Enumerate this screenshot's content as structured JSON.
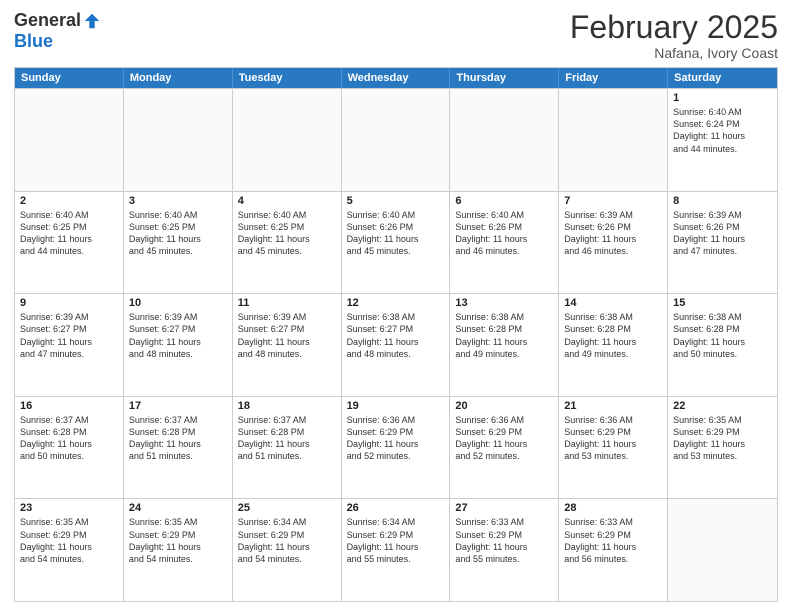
{
  "header": {
    "logo_general": "General",
    "logo_blue": "Blue",
    "month_title": "February 2025",
    "location": "Nafana, Ivory Coast"
  },
  "weekdays": [
    "Sunday",
    "Monday",
    "Tuesday",
    "Wednesday",
    "Thursday",
    "Friday",
    "Saturday"
  ],
  "weeks": [
    [
      {
        "day": "",
        "info": ""
      },
      {
        "day": "",
        "info": ""
      },
      {
        "day": "",
        "info": ""
      },
      {
        "day": "",
        "info": ""
      },
      {
        "day": "",
        "info": ""
      },
      {
        "day": "",
        "info": ""
      },
      {
        "day": "1",
        "info": "Sunrise: 6:40 AM\nSunset: 6:24 PM\nDaylight: 11 hours\nand 44 minutes."
      }
    ],
    [
      {
        "day": "2",
        "info": "Sunrise: 6:40 AM\nSunset: 6:25 PM\nDaylight: 11 hours\nand 44 minutes."
      },
      {
        "day": "3",
        "info": "Sunrise: 6:40 AM\nSunset: 6:25 PM\nDaylight: 11 hours\nand 45 minutes."
      },
      {
        "day": "4",
        "info": "Sunrise: 6:40 AM\nSunset: 6:25 PM\nDaylight: 11 hours\nand 45 minutes."
      },
      {
        "day": "5",
        "info": "Sunrise: 6:40 AM\nSunset: 6:26 PM\nDaylight: 11 hours\nand 45 minutes."
      },
      {
        "day": "6",
        "info": "Sunrise: 6:40 AM\nSunset: 6:26 PM\nDaylight: 11 hours\nand 46 minutes."
      },
      {
        "day": "7",
        "info": "Sunrise: 6:39 AM\nSunset: 6:26 PM\nDaylight: 11 hours\nand 46 minutes."
      },
      {
        "day": "8",
        "info": "Sunrise: 6:39 AM\nSunset: 6:26 PM\nDaylight: 11 hours\nand 47 minutes."
      }
    ],
    [
      {
        "day": "9",
        "info": "Sunrise: 6:39 AM\nSunset: 6:27 PM\nDaylight: 11 hours\nand 47 minutes."
      },
      {
        "day": "10",
        "info": "Sunrise: 6:39 AM\nSunset: 6:27 PM\nDaylight: 11 hours\nand 48 minutes."
      },
      {
        "day": "11",
        "info": "Sunrise: 6:39 AM\nSunset: 6:27 PM\nDaylight: 11 hours\nand 48 minutes."
      },
      {
        "day": "12",
        "info": "Sunrise: 6:38 AM\nSunset: 6:27 PM\nDaylight: 11 hours\nand 48 minutes."
      },
      {
        "day": "13",
        "info": "Sunrise: 6:38 AM\nSunset: 6:28 PM\nDaylight: 11 hours\nand 49 minutes."
      },
      {
        "day": "14",
        "info": "Sunrise: 6:38 AM\nSunset: 6:28 PM\nDaylight: 11 hours\nand 49 minutes."
      },
      {
        "day": "15",
        "info": "Sunrise: 6:38 AM\nSunset: 6:28 PM\nDaylight: 11 hours\nand 50 minutes."
      }
    ],
    [
      {
        "day": "16",
        "info": "Sunrise: 6:37 AM\nSunset: 6:28 PM\nDaylight: 11 hours\nand 50 minutes."
      },
      {
        "day": "17",
        "info": "Sunrise: 6:37 AM\nSunset: 6:28 PM\nDaylight: 11 hours\nand 51 minutes."
      },
      {
        "day": "18",
        "info": "Sunrise: 6:37 AM\nSunset: 6:28 PM\nDaylight: 11 hours\nand 51 minutes."
      },
      {
        "day": "19",
        "info": "Sunrise: 6:36 AM\nSunset: 6:29 PM\nDaylight: 11 hours\nand 52 minutes."
      },
      {
        "day": "20",
        "info": "Sunrise: 6:36 AM\nSunset: 6:29 PM\nDaylight: 11 hours\nand 52 minutes."
      },
      {
        "day": "21",
        "info": "Sunrise: 6:36 AM\nSunset: 6:29 PM\nDaylight: 11 hours\nand 53 minutes."
      },
      {
        "day": "22",
        "info": "Sunrise: 6:35 AM\nSunset: 6:29 PM\nDaylight: 11 hours\nand 53 minutes."
      }
    ],
    [
      {
        "day": "23",
        "info": "Sunrise: 6:35 AM\nSunset: 6:29 PM\nDaylight: 11 hours\nand 54 minutes."
      },
      {
        "day": "24",
        "info": "Sunrise: 6:35 AM\nSunset: 6:29 PM\nDaylight: 11 hours\nand 54 minutes."
      },
      {
        "day": "25",
        "info": "Sunrise: 6:34 AM\nSunset: 6:29 PM\nDaylight: 11 hours\nand 54 minutes."
      },
      {
        "day": "26",
        "info": "Sunrise: 6:34 AM\nSunset: 6:29 PM\nDaylight: 11 hours\nand 55 minutes."
      },
      {
        "day": "27",
        "info": "Sunrise: 6:33 AM\nSunset: 6:29 PM\nDaylight: 11 hours\nand 55 minutes."
      },
      {
        "day": "28",
        "info": "Sunrise: 6:33 AM\nSunset: 6:29 PM\nDaylight: 11 hours\nand 56 minutes."
      },
      {
        "day": "",
        "info": ""
      }
    ]
  ]
}
